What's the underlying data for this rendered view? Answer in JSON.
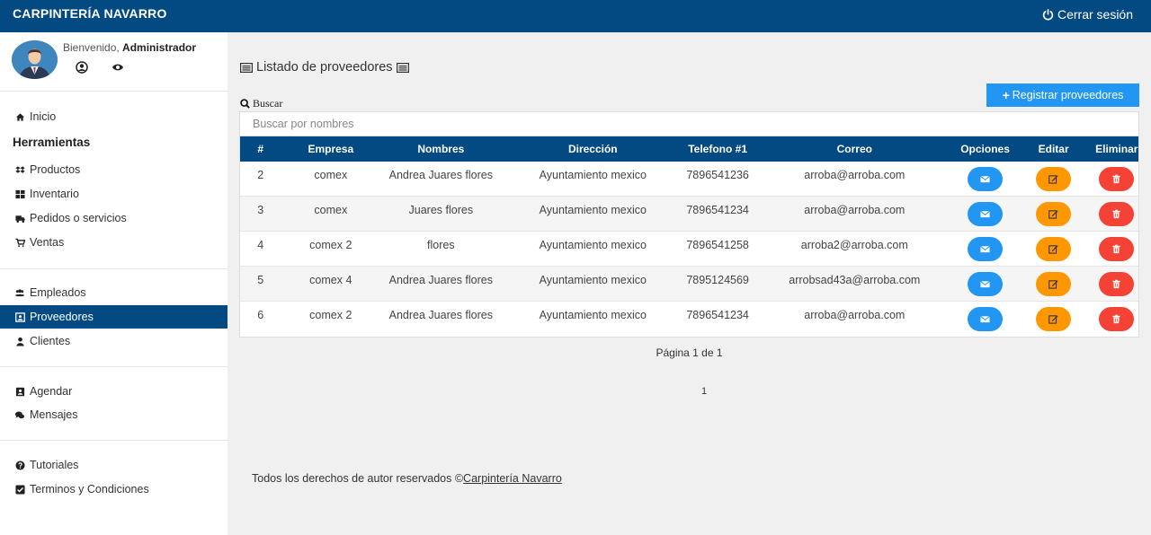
{
  "topbar": {
    "brand": "CARPINTERÍA NAVARRO",
    "logout_label": "Cerrar sesión"
  },
  "profile": {
    "welcome_prefix": "Bienvenido, ",
    "user_name": "Administrador"
  },
  "sidebar": {
    "inicio": "Inicio",
    "tools_title": "Herramientas",
    "productos": "Productos",
    "inventario": "Inventario",
    "pedidos": "Pedidos o servicios",
    "ventas": "Ventas",
    "empleados": "Empleados",
    "proveedores": "Proveedores",
    "clientes": "Clientes",
    "agendar": "Agendar",
    "mensajes": "Mensajes",
    "tutoriales": "Tutoriales",
    "terminos": "Terminos y Condiciones"
  },
  "main": {
    "title": "Listado de proveedores",
    "register_label": "Registrar proveedores",
    "search_label": "Buscar",
    "search_placeholder": "Buscar por nombres"
  },
  "table": {
    "headers": [
      "#",
      "Empresa",
      "Nombres",
      "Dirección",
      "Telefono #1",
      "Correo",
      "Opciones",
      "Editar",
      "Eliminar"
    ],
    "rows": [
      {
        "id": "2",
        "empresa": "comex",
        "nombres": "Andrea Juares flores",
        "direccion": "Ayuntamiento mexico",
        "telefono": "7896541236",
        "correo": "arroba@arroba.com"
      },
      {
        "id": "3",
        "empresa": "comex",
        "nombres": "Juares flores",
        "direccion": "Ayuntamiento mexico",
        "telefono": "7896541234",
        "correo": "arroba@arroba.com"
      },
      {
        "id": "4",
        "empresa": "comex 2",
        "nombres": "flores",
        "direccion": "Ayuntamiento mexico",
        "telefono": "7896541258",
        "correo": "arroba2@arroba.com"
      },
      {
        "id": "5",
        "empresa": "comex 4",
        "nombres": "Andrea Juares flores",
        "direccion": "Ayuntamiento mexico",
        "telefono": "7895124569",
        "correo": "arrobsad43a@arroba.com"
      },
      {
        "id": "6",
        "empresa": "comex 2",
        "nombres": "Andrea Juares flores",
        "direccion": "Ayuntamiento mexico",
        "telefono": "7896541234",
        "correo": "arroba@arroba.com"
      }
    ]
  },
  "pagination": {
    "info": "Página 1 de 1",
    "page": "1"
  },
  "footer": {
    "text": "Todos los derechos de autor reservados ©",
    "link": "Carpintería Navarro"
  },
  "colors": {
    "primary": "#044a82",
    "info": "#2196f3",
    "warning": "#ff9800",
    "danger": "#f44336"
  },
  "icons": {
    "logout": "power-icon",
    "inicio": "home-icon",
    "productos": "dropbox-icon",
    "inventario": "grid-icon",
    "pedidos": "truck-icon",
    "ventas": "cart-icon",
    "empleados": "users-icon",
    "proveedores": "id-card-icon",
    "clientes": "user-icon",
    "agendar": "contact-book-icon",
    "mensajes": "comments-icon",
    "tutoriales": "question-icon",
    "terminos": "check-square-icon",
    "options": "envelope-icon",
    "edit": "edit-icon",
    "delete": "trash-icon"
  }
}
